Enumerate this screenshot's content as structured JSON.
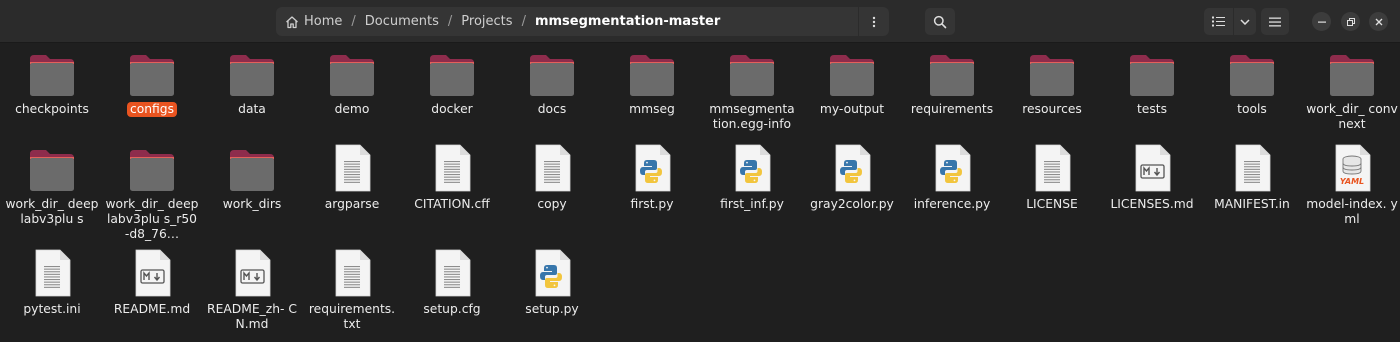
{
  "breadcrumbs": [
    "Home",
    "Documents",
    "Projects",
    "mmsegmentation-master"
  ],
  "colors": {
    "accent": "#e95420",
    "folder_tab": "#8e2c4c",
    "folder_body": "#6b6b6b",
    "window_bg": "#1f1f1f"
  },
  "items": [
    {
      "name": "checkpoints",
      "type": "folder"
    },
    {
      "name": "configs",
      "type": "folder",
      "selected": true
    },
    {
      "name": "data",
      "type": "folder"
    },
    {
      "name": "demo",
      "type": "folder"
    },
    {
      "name": "docker",
      "type": "folder"
    },
    {
      "name": "docs",
      "type": "folder"
    },
    {
      "name": "mmseg",
      "type": "folder"
    },
    {
      "name": "mmsegmentation.egg-info",
      "display": "mmsegmenta tion.egg-info",
      "type": "folder"
    },
    {
      "name": "my-output",
      "type": "folder"
    },
    {
      "name": "requirements",
      "type": "folder"
    },
    {
      "name": "resources",
      "type": "folder"
    },
    {
      "name": "tests",
      "type": "folder"
    },
    {
      "name": "tools",
      "type": "folder"
    },
    {
      "name": "work_dir_convnext",
      "display": "work_dir_ convnext",
      "type": "folder"
    },
    {
      "name": "work_dir_deeplabv3plus",
      "display": "work_dir_ deeplabv3plu s",
      "type": "folder"
    },
    {
      "name": "work_dir_deeplabv3plus_r50-d8_76…",
      "display": "work_dir_ deeplabv3plu s_r50-d8_76…",
      "type": "folder"
    },
    {
      "name": "work_dirs",
      "type": "folder"
    },
    {
      "name": "argparse",
      "type": "text"
    },
    {
      "name": "CITATION.cff",
      "type": "text"
    },
    {
      "name": "copy",
      "type": "text"
    },
    {
      "name": "first.py",
      "type": "python"
    },
    {
      "name": "first_inf.py",
      "type": "python"
    },
    {
      "name": "gray2color.py",
      "type": "python"
    },
    {
      "name": "inference.py",
      "type": "python"
    },
    {
      "name": "LICENSE",
      "type": "text"
    },
    {
      "name": "LICENSES.md",
      "type": "markdown"
    },
    {
      "name": "MANIFEST.in",
      "type": "text"
    },
    {
      "name": "model-index.yml",
      "display": "model-index. yml",
      "type": "yaml"
    },
    {
      "name": "pytest.ini",
      "type": "text"
    },
    {
      "name": "README.md",
      "type": "markdown"
    },
    {
      "name": "README_zh-CN.md",
      "display": "README_zh- CN.md",
      "type": "markdown"
    },
    {
      "name": "requirements.txt",
      "display": "requirements. txt",
      "type": "text"
    },
    {
      "name": "setup.cfg",
      "type": "text"
    },
    {
      "name": "setup.py",
      "type": "python"
    }
  ],
  "icons": {
    "home": "home-icon",
    "menu": "vertical-dots-icon",
    "search": "search-icon",
    "view": "list-view-icon",
    "dropdown": "chevron-down-icon",
    "hamburger": "hamburger-menu-icon",
    "minimize": "minimize-icon",
    "maximize": "restore-icon",
    "close": "close-icon"
  }
}
